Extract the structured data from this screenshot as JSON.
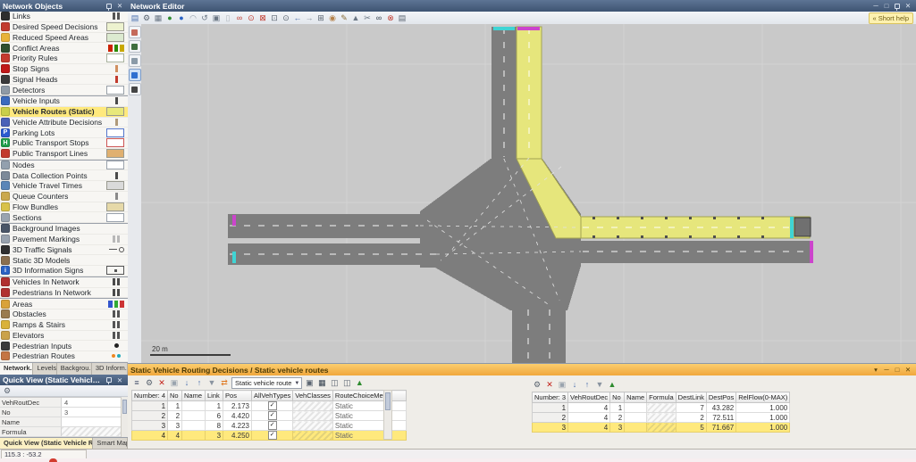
{
  "network_objects_panel": {
    "title": "Network Objects",
    "items": [
      {
        "label": "Links",
        "icon": "links-icon",
        "icon_color": "#2e2e2e",
        "swatch": {
          "type": "bars",
          "colors": [
            "#555555"
          ]
        }
      },
      {
        "label": "Desired Speed Decisions",
        "icon": "desired-speed-decisions-icon",
        "icon_color": "#c23b2e",
        "swatch": {
          "type": "fill",
          "colors": [
            "#edf2cf"
          ]
        }
      },
      {
        "label": "Reduced Speed Areas",
        "icon": "reduced-speed-areas-icon",
        "icon_color": "#e8b33a",
        "swatch": {
          "type": "fill",
          "colors": [
            "#dcead0"
          ]
        }
      },
      {
        "label": "Conflict Areas",
        "icon": "conflict-areas-icon",
        "icon_color": "#2f4f2f",
        "swatch": {
          "type": "multi",
          "colors": [
            "#cc2200",
            "#2a8a00",
            "#c8a800"
          ]
        }
      },
      {
        "label": "Priority Rules",
        "icon": "priority-rules-icon",
        "icon_color": "#c43a2e",
        "swatch": {
          "type": "outline",
          "colors": [
            "#a8b29e"
          ]
        }
      },
      {
        "label": "Stop Signs",
        "icon": "stop-signs-icon",
        "icon_color": "#c01818",
        "swatch": {
          "type": "bar",
          "colors": [
            "#d09060"
          ]
        }
      },
      {
        "label": "Signal Heads",
        "icon": "signal-heads-icon",
        "icon_color": "#3a3a3a",
        "swatch": {
          "type": "bar",
          "colors": [
            "#c23b2e"
          ]
        }
      },
      {
        "label": "Detectors",
        "icon": "detectors-icon",
        "icon_color": "#8f9aa6",
        "swatch": {
          "type": "outline",
          "colors": [
            "#98a0a8"
          ]
        }
      },
      {
        "label": "Vehicle Inputs",
        "icon": "vehicle-inputs-icon",
        "icon_color": "#3a6abf",
        "group_start": true,
        "swatch": {
          "type": "bar",
          "colors": [
            "#4a4a4a"
          ]
        }
      },
      {
        "label": "Vehicle Routes (Static)",
        "icon": "vehicle-routes-static-icon",
        "icon_color": "#c9cf4a",
        "selected": true,
        "swatch": {
          "type": "fill",
          "colors": [
            "#e8e87a"
          ]
        }
      },
      {
        "label": "Vehicle Attribute Decisions",
        "icon": "vehicle-attribute-decisions-icon",
        "icon_color": "#4a62b8",
        "swatch": {
          "type": "bar",
          "colors": [
            "#b09a7a"
          ]
        }
      },
      {
        "label": "Parking Lots",
        "icon": "parking-lots-icon",
        "icon_color": "#2a5ad0",
        "glyph": "P",
        "swatch": {
          "type": "outline",
          "colors": [
            "#5577cc"
          ]
        }
      },
      {
        "label": "Public Transport Stops",
        "icon": "public-transport-stops-icon",
        "icon_color": "#1f9e4b",
        "glyph": "H",
        "swatch": {
          "type": "outline",
          "colors": [
            "#cc5555"
          ]
        }
      },
      {
        "label": "Public Transport Lines",
        "icon": "public-transport-lines-icon",
        "icon_color": "#c23b2e",
        "swatch": {
          "type": "fill",
          "colors": [
            "#e0b070"
          ]
        }
      },
      {
        "label": "Nodes",
        "icon": "nodes-icon",
        "icon_color": "#93a0ae",
        "group_start": true,
        "swatch": {
          "type": "outline",
          "colors": [
            "#9aa2ac"
          ]
        }
      },
      {
        "label": "Data Collection Points",
        "icon": "data-collection-points-icon",
        "icon_color": "#7c8a99",
        "swatch": {
          "type": "bar",
          "colors": [
            "#4a4a4a"
          ]
        }
      },
      {
        "label": "Vehicle Travel Times",
        "icon": "vehicle-travel-times-icon",
        "icon_color": "#5a86b8",
        "swatch": {
          "type": "fill",
          "colors": [
            "#dadada"
          ]
        }
      },
      {
        "label": "Queue Counters",
        "icon": "queue-counters-icon",
        "icon_color": "#caa84c",
        "swatch": {
          "type": "bar",
          "colors": [
            "#8a8a8a"
          ]
        }
      },
      {
        "label": "Flow Bundles",
        "icon": "flow-bundles-icon",
        "icon_color": "#d8c24a",
        "swatch": {
          "type": "fill",
          "colors": [
            "#e6d9a8"
          ]
        }
      },
      {
        "label": "Sections",
        "icon": "sections-icon",
        "icon_color": "#9aa4b0",
        "swatch": {
          "type": "outline",
          "colors": [
            "#9aa2ac"
          ]
        }
      },
      {
        "label": "Background Images",
        "icon": "background-images-icon",
        "icon_color": "#4a5668",
        "group_start": true,
        "swatch": {
          "type": "none",
          "colors": []
        }
      },
      {
        "label": "Pavement Markings",
        "icon": "pavement-markings-icon",
        "icon_color": "#98a2ae",
        "swatch": {
          "type": "bars",
          "colors": [
            "#b8b8b8"
          ]
        }
      },
      {
        "label": "3D Traffic Signals",
        "icon": "traffic-signals-3d-icon",
        "icon_color": "#303030",
        "swatch": {
          "type": "linecircle",
          "colors": [
            "#555555"
          ]
        }
      },
      {
        "label": "Static 3D Models",
        "icon": "static-3d-models-icon",
        "icon_color": "#8a6f4e",
        "swatch": {
          "type": "none",
          "colors": []
        }
      },
      {
        "label": "3D Information Signs",
        "icon": "information-signs-3d-icon",
        "icon_color": "#2a62c4",
        "glyph": "i",
        "swatch": {
          "type": "dotbox",
          "colors": [
            "#555555"
          ]
        }
      },
      {
        "label": "Vehicles In Network",
        "icon": "vehicles-in-network-icon",
        "icon_color": "#b03030",
        "group_start": true,
        "swatch": {
          "type": "bars",
          "colors": [
            "#4a4a4a"
          ]
        }
      },
      {
        "label": "Pedestrians In Network",
        "icon": "pedestrians-in-network-icon",
        "icon_color": "#b03030",
        "swatch": {
          "type": "bars",
          "colors": [
            "#4a4a4a"
          ]
        }
      },
      {
        "label": "Areas",
        "icon": "areas-icon",
        "icon_color": "#d9a23a",
        "group_start": true,
        "swatch": {
          "type": "multi",
          "colors": [
            "#3355cc",
            "#33aa33",
            "#cc3333"
          ]
        }
      },
      {
        "label": "Obstacles",
        "icon": "obstacles-icon",
        "icon_color": "#9a7b4f",
        "swatch": {
          "type": "bars",
          "colors": [
            "#555555"
          ]
        }
      },
      {
        "label": "Ramps & Stairs",
        "icon": "ramps-stairs-icon",
        "icon_color": "#d9b23a",
        "swatch": {
          "type": "bars",
          "colors": [
            "#555555"
          ]
        }
      },
      {
        "label": "Elevators",
        "icon": "elevators-icon",
        "icon_color": "#caa24a",
        "swatch": {
          "type": "bars",
          "colors": [
            "#555555"
          ]
        }
      },
      {
        "label": "Pedestrian Inputs",
        "icon": "pedestrian-inputs-icon",
        "icon_color": "#3a3a3a",
        "swatch": {
          "type": "dot",
          "colors": [
            "#222222"
          ]
        }
      },
      {
        "label": "Pedestrian Routes",
        "icon": "pedestrian-routes-icon",
        "icon_color": "#c47544",
        "swatch": {
          "type": "dots2",
          "colors": [
            "#ee8822",
            "#22aabb"
          ]
        }
      }
    ],
    "tabs": [
      "Network...",
      "Levels",
      "Backgrou...",
      "3D Inform..."
    ],
    "active_tab": 0
  },
  "quick_view": {
    "title": "Quick View (Static Vehicle Routes)",
    "toolbar": [
      {
        "name": "wrench-icon",
        "glyph": "⚙",
        "color": "#5a6470"
      }
    ],
    "rows": [
      {
        "label": "VehRoutDec",
        "value": "4"
      },
      {
        "label": "No",
        "value": "3"
      },
      {
        "label": "Name",
        "value": ""
      },
      {
        "label": "Formula",
        "value": "",
        "hatched": true
      }
    ],
    "tabs": [
      "Quick View (Static Vehicle Rout...",
      "Smart Map"
    ],
    "active_tab": 0
  },
  "network_editor": {
    "title": "Network Editor",
    "short_help": "« Short help",
    "scale_label": "20 m",
    "toolbar": [
      {
        "name": "select-mode-icon",
        "glyph": "▤",
        "color": "#4a6fae"
      },
      {
        "name": "wrench-icon",
        "glyph": "⚙",
        "color": "#5a6470"
      },
      {
        "name": "edit-network-icon",
        "glyph": "▦",
        "color": "#6a7684"
      },
      {
        "name": "globe-icon",
        "glyph": "●",
        "color": "#2e8b2e"
      },
      {
        "name": "map-marker-icon",
        "glyph": "●",
        "color": "#2a62c4"
      },
      {
        "name": "lasso-icon",
        "glyph": "◠",
        "color": "#8a94a0"
      },
      {
        "name": "rotate-view-icon",
        "glyph": "↺",
        "color": "#6a7684"
      },
      {
        "name": "copy-icon",
        "glyph": "▣",
        "color": "#6a7684"
      },
      {
        "name": "paste-icon",
        "glyph": "▯",
        "color": "#b0b6bc"
      },
      {
        "name": "binoculars-icon",
        "glyph": "∞",
        "color": "#c23b2e"
      },
      {
        "name": "zoom-selection-icon",
        "glyph": "⊙",
        "color": "#c23b2e"
      },
      {
        "name": "show-entire-network-icon",
        "glyph": "⊠",
        "color": "#c23b2e"
      },
      {
        "name": "zoom-window-icon",
        "glyph": "⊡",
        "color": "#5a6470"
      },
      {
        "name": "magnifier-icon",
        "glyph": "⊙",
        "color": "#5a6470"
      },
      {
        "name": "previous-view-icon",
        "glyph": "←",
        "color": "#4a6fae"
      },
      {
        "name": "next-view-icon",
        "glyph": "→",
        "color": "#8a94a0"
      },
      {
        "name": "vehicle-display-icon",
        "glyph": "⊞",
        "color": "#5a6470"
      },
      {
        "name": "pan-icon",
        "glyph": "◉",
        "color": "#b5824a"
      },
      {
        "name": "edit-pencil-icon",
        "glyph": "✎",
        "color": "#8a6f3a"
      },
      {
        "name": "node-tool-icon",
        "glyph": "▲",
        "color": "#6a7684"
      },
      {
        "name": "cut-icon",
        "glyph": "✂",
        "color": "#6a7684"
      },
      {
        "name": "find-icon",
        "glyph": "∞",
        "color": "#34404e"
      },
      {
        "name": "camera-off-icon",
        "glyph": "⊗",
        "color": "#c23b2e"
      },
      {
        "name": "print-icon",
        "glyph": "▤",
        "color": "#5a6470"
      }
    ],
    "side_tools": [
      {
        "name": "editor-tool-signal-icon",
        "color": "#c46a5a"
      },
      {
        "name": "editor-tool-level-icon",
        "color": "#3f6f3f"
      },
      {
        "name": "editor-tool-background-icon",
        "color": "#8a9aa8"
      },
      {
        "name": "editor-tool-smartmap-icon",
        "color": "#2f6fd0",
        "pressed": true
      },
      {
        "name": "editor-tool-presentation-icon",
        "color": "#444444"
      }
    ],
    "window_buttons": [
      "minimize",
      "maximize",
      "pin",
      "close"
    ]
  },
  "routes_panel": {
    "title": "Static Vehicle Routing Decisions / Static vehicle routes",
    "relation_dropdown": "Static vehicle route",
    "left_toolbar": [
      {
        "name": "list-menu-icon",
        "glyph": "≡",
        "color": "#44506a"
      },
      {
        "name": "wrench-icon",
        "glyph": "⚙",
        "color": "#5a6470"
      },
      {
        "name": "delete-icon",
        "glyph": "✕",
        "color": "#c22018"
      },
      {
        "name": "duplicate-icon",
        "glyph": "▣",
        "color": "#9aa4ae"
      },
      {
        "name": "sort-ascending-icon",
        "glyph": "↓",
        "color": "#4a6fae"
      },
      {
        "name": "sort-descending-icon",
        "glyph": "↑",
        "color": "#4a6fae"
      },
      {
        "name": "filter-icon",
        "glyph": "▼",
        "color": "#8a94a0"
      },
      {
        "name": "sync-selection-icon",
        "glyph": "⇄",
        "color": "#e07820"
      }
    ],
    "left_toolbar_after": [
      {
        "name": "copy-attributes-icon",
        "glyph": "▣",
        "color": "#5a6470"
      },
      {
        "name": "attribute-table-icon",
        "glyph": "▦",
        "color": "#34404e"
      },
      {
        "name": "save-layout-icon",
        "glyph": "◫",
        "color": "#5a6470"
      },
      {
        "name": "load-layout-icon",
        "glyph": "◫",
        "color": "#5a6470"
      },
      {
        "name": "chart-icon",
        "glyph": "▲",
        "color": "#2e8b2e"
      }
    ],
    "right_toolbar": [
      {
        "name": "wrench-icon",
        "glyph": "⚙",
        "color": "#5a6470"
      },
      {
        "name": "delete-icon",
        "glyph": "✕",
        "color": "#c22018"
      },
      {
        "name": "duplicate-icon",
        "glyph": "▣",
        "color": "#9aa4ae"
      },
      {
        "name": "sort-ascending-icon",
        "glyph": "↓",
        "color": "#4a6fae"
      },
      {
        "name": "sort-descending-icon",
        "glyph": "↑",
        "color": "#4a6fae"
      },
      {
        "name": "filter-icon",
        "glyph": "▼",
        "color": "#8a94a0"
      },
      {
        "name": "chart-icon",
        "glyph": "▲",
        "color": "#2e8b2e"
      }
    ],
    "decisions_table": {
      "count_header": "Number: 4",
      "columns": [
        "No",
        "Name",
        "Link",
        "Pos",
        "AllVehTypes",
        "VehClasses",
        "RouteChoiceMeth"
      ],
      "rows": [
        {
          "num": "1",
          "no": "1",
          "name": "",
          "link": "1",
          "pos": "2.173",
          "all_veh_types": true,
          "route_choice": "Static",
          "selected": false
        },
        {
          "num": "2",
          "no": "2",
          "name": "",
          "link": "6",
          "pos": "4.420",
          "all_veh_types": true,
          "route_choice": "Static",
          "selected": false
        },
        {
          "num": "3",
          "no": "3",
          "name": "",
          "link": "8",
          "pos": "4.223",
          "all_veh_types": true,
          "route_choice": "Static",
          "selected": false
        },
        {
          "num": "4",
          "no": "4",
          "name": "",
          "link": "3",
          "pos": "4.250",
          "all_veh_types": true,
          "route_choice": "Static",
          "selected": true
        }
      ]
    },
    "routes_table": {
      "count_header": "Number: 3",
      "columns": [
        "VehRoutDec",
        "No",
        "Name",
        "Formula",
        "DestLink",
        "DestPos",
        "RelFlow(0-MAX)"
      ],
      "rows": [
        {
          "num": "1",
          "veh_rout_dec": "4",
          "no": "1",
          "name": "",
          "formula_hatched": true,
          "dest_link": "7",
          "dest_pos": "43.282",
          "rel_flow": "1.000",
          "selected": false
        },
        {
          "num": "2",
          "veh_rout_dec": "4",
          "no": "2",
          "name": "",
          "formula_hatched": true,
          "dest_link": "2",
          "dest_pos": "72.511",
          "rel_flow": "1.000",
          "selected": false
        },
        {
          "num": "3",
          "veh_rout_dec": "4",
          "no": "3",
          "name": "",
          "formula_hatched": true,
          "dest_link": "5",
          "dest_pos": "71.667",
          "rel_flow": "1.000",
          "selected": true
        }
      ]
    },
    "window_buttons": [
      "menu",
      "minimize",
      "maximize",
      "close"
    ]
  },
  "status_bar": {
    "coordinates": "115.3 : -53.2"
  },
  "colors": {
    "canvas_bg": "#c9c9c9",
    "road_gray": "#7d7d7d",
    "route_yellow": "#e6e67c",
    "route_yellow_edge": "#a2a252",
    "selection_yellow": "#ffe97d",
    "panel_title_blue": "#46618a",
    "panel_title_orange": "#f2ab40",
    "marker_cyan": "#3fd4d4",
    "marker_magenta": "#cc44cc"
  }
}
